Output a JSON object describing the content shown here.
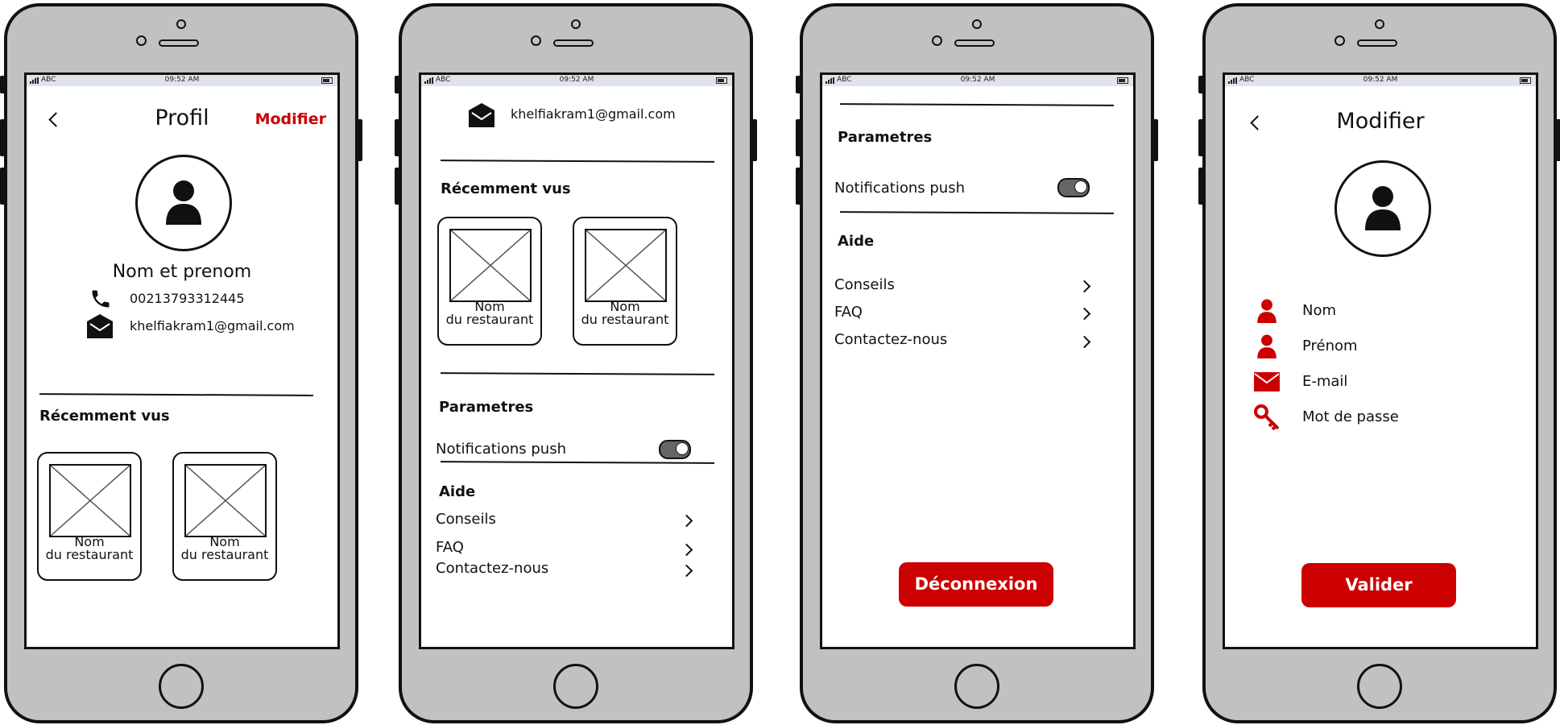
{
  "status_bar": {
    "carrier": "ABC",
    "time": "09:52 AM"
  },
  "screen1": {
    "title": "Profil",
    "edit_label": "Modifier",
    "name": "Nom et prenom",
    "phone": "00213793312445",
    "email": "khelfiakram1@gmail.com",
    "recent_heading": "Récemment vus",
    "cards": [
      {
        "line1": "Nom",
        "line2": "du restaurant"
      },
      {
        "line1": "Nom",
        "line2": "du restaurant"
      }
    ]
  },
  "screen2": {
    "email": "khelfiakram1@gmail.com",
    "recent_heading": "Récemment vus",
    "cards": [
      {
        "line1": "Nom",
        "line2": "du restaurant"
      },
      {
        "line1": "Nom",
        "line2": "du restaurant"
      }
    ],
    "settings_heading": "Parametres",
    "push_label": "Notifications push",
    "help_heading": "Aide",
    "help_items": [
      "Conseils",
      "FAQ",
      "Contactez-nous"
    ]
  },
  "screen3": {
    "settings_heading": "Parametres",
    "push_label": "Notifications push",
    "help_heading": "Aide",
    "help_items": [
      "Conseils",
      "FAQ",
      "Contactez-nous"
    ],
    "logout_label": "Déconnexion"
  },
  "screen4": {
    "title": "Modifier",
    "fields": [
      {
        "label": "Nom",
        "icon": "user-icon"
      },
      {
        "label": "Prénom",
        "icon": "user-icon"
      },
      {
        "label": "E-mail",
        "icon": "envelope-icon"
      },
      {
        "label": "Mot de passe",
        "icon": "key-icon"
      }
    ],
    "submit_label": "Valider"
  },
  "colors": {
    "accent": "#cc0000",
    "phone_body": "#c1c1c1",
    "status_bar": "#dfe3ea"
  }
}
